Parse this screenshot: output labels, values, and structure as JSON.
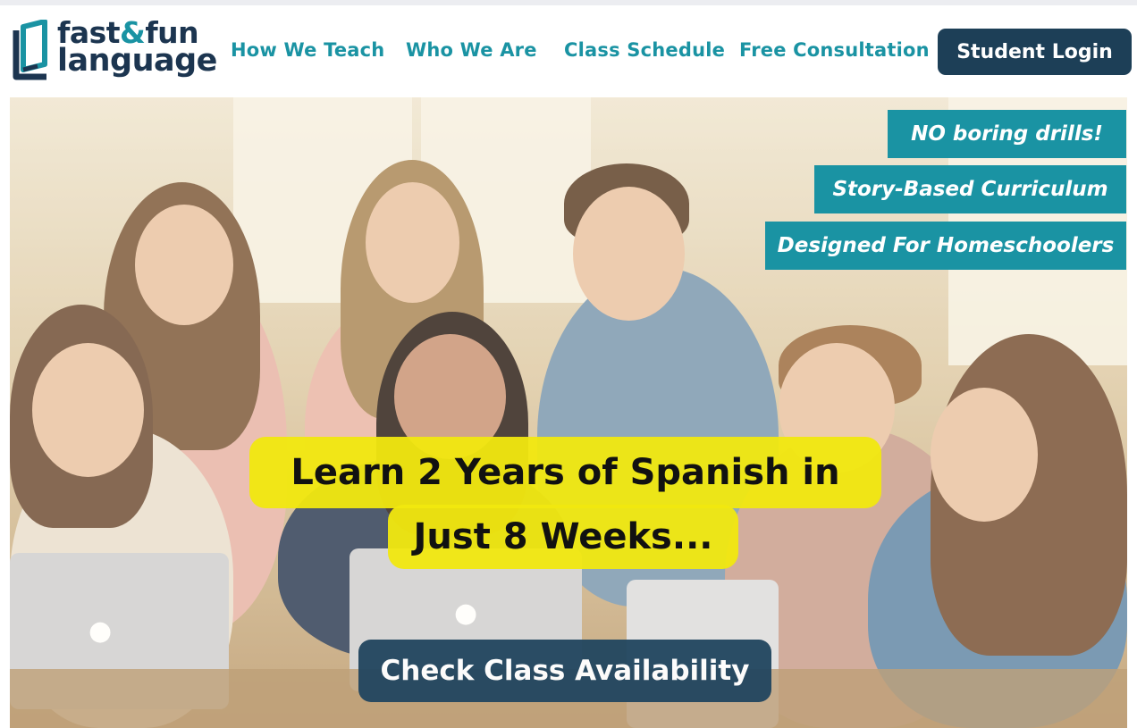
{
  "logo": {
    "line1_a": "fast",
    "line1_amp": "&",
    "line1_b": "fun",
    "line2": "language"
  },
  "nav": [
    {
      "label": "How We Teach"
    },
    {
      "label": "Who We Are"
    },
    {
      "label": "Class Schedule"
    },
    {
      "label": "Free Consultation"
    }
  ],
  "login_label": "Student Login",
  "hero": {
    "tags": [
      "NO boring drills!",
      "Story-Based Curriculum",
      "Designed For Homeschoolers"
    ],
    "headline_line1": "Learn 2 Years of Spanish in",
    "headline_line2": "Just 8 Weeks...",
    "cta_label": "Check Class Availability",
    "laptop_icon": "apple-logo-icon"
  },
  "colors": {
    "teal": "#1a93a3",
    "navy": "#1d3f57",
    "highlight": "#f1e80f"
  }
}
